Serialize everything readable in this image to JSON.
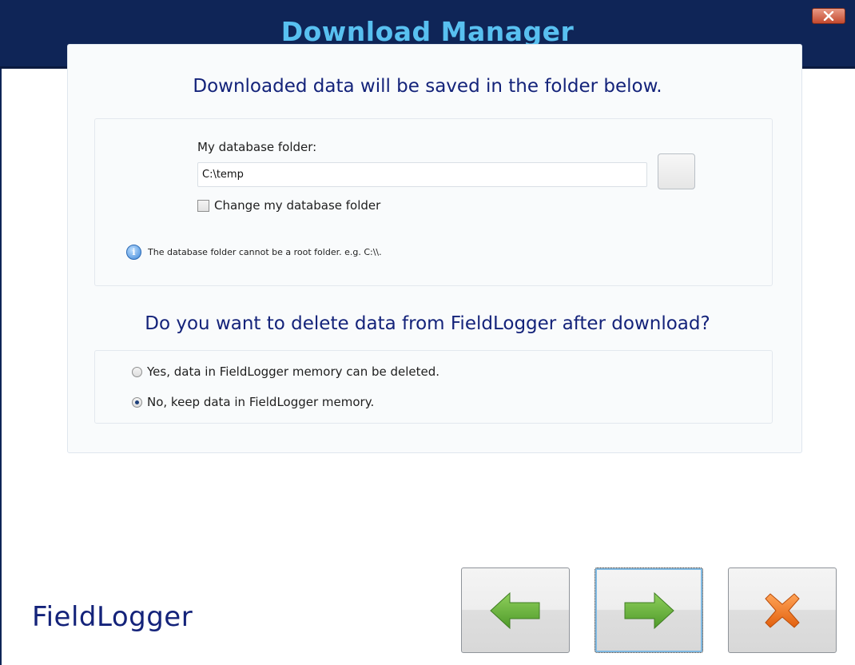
{
  "window": {
    "title": "Download Manager",
    "close_icon": "close-icon"
  },
  "folder_section": {
    "heading": "Downloaded data will be saved in the folder below.",
    "field_label": "My database folder:",
    "path_value": "C:\\temp",
    "browse_icon": "browse-folder-button",
    "change_checkbox_label": "Change my database folder",
    "change_checked": false,
    "info_icon": "info-icon",
    "info_text": "The database folder cannot be a root folder. e.g. C:\\\\."
  },
  "delete_section": {
    "heading": "Do you want to delete data from FieldLogger after download?",
    "options": [
      {
        "label": "Yes, data in FieldLogger memory can be deleted.",
        "selected": false
      },
      {
        "label": "No, keep data in FieldLogger memory.",
        "selected": true
      }
    ]
  },
  "footer": {
    "logo_text": "FieldLogger",
    "back_icon": "arrow-left-icon",
    "next_icon": "arrow-right-icon",
    "cancel_icon": "x-cancel-icon"
  },
  "colors": {
    "titlebar": "#0f2557",
    "title_text": "#58c0f0",
    "heading_text": "#14237a",
    "arrow_green": "#5aa532",
    "cancel_orange": "#f07a1e"
  }
}
